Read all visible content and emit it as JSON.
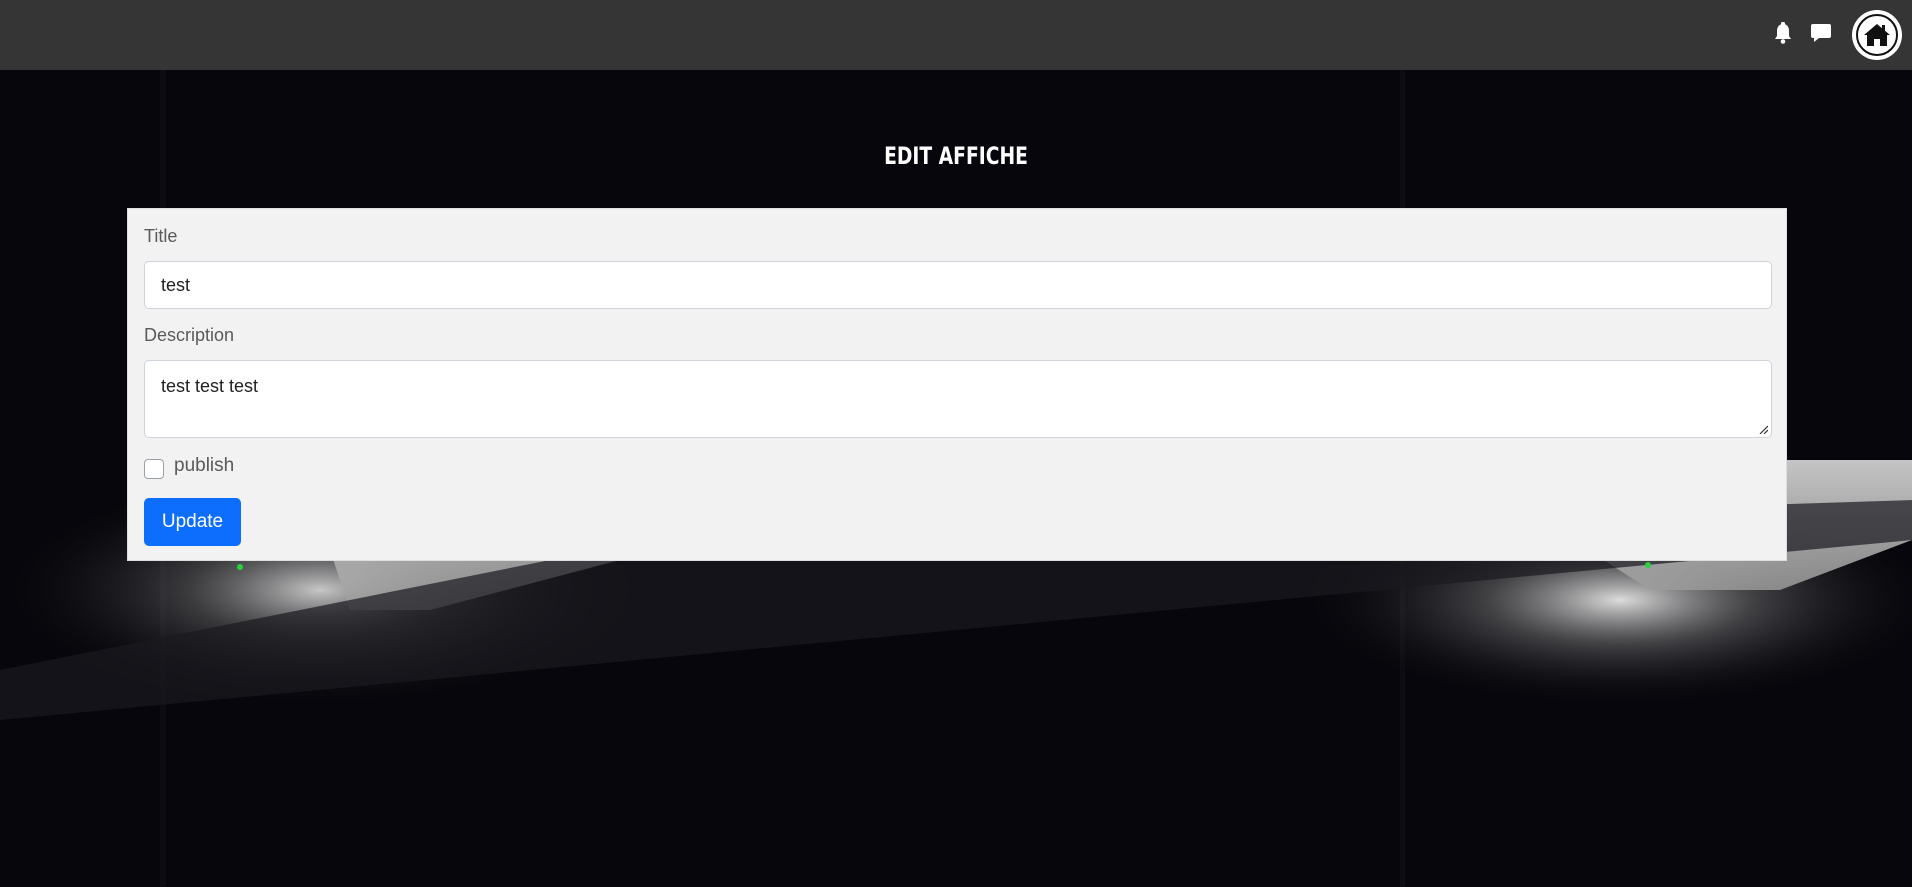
{
  "navbar": {
    "icons": [
      "bell-icon",
      "chat-icon",
      "home-icon"
    ],
    "bg_color": "#353535"
  },
  "page": {
    "title": "EDIT AFFICHE"
  },
  "form": {
    "title_label": "Title",
    "title_value": "test",
    "description_label": "Description",
    "description_value": "test test test",
    "publish_label": "publish",
    "publish_checked": false,
    "submit_label": "Update",
    "accent_color": "#0d6efd"
  }
}
